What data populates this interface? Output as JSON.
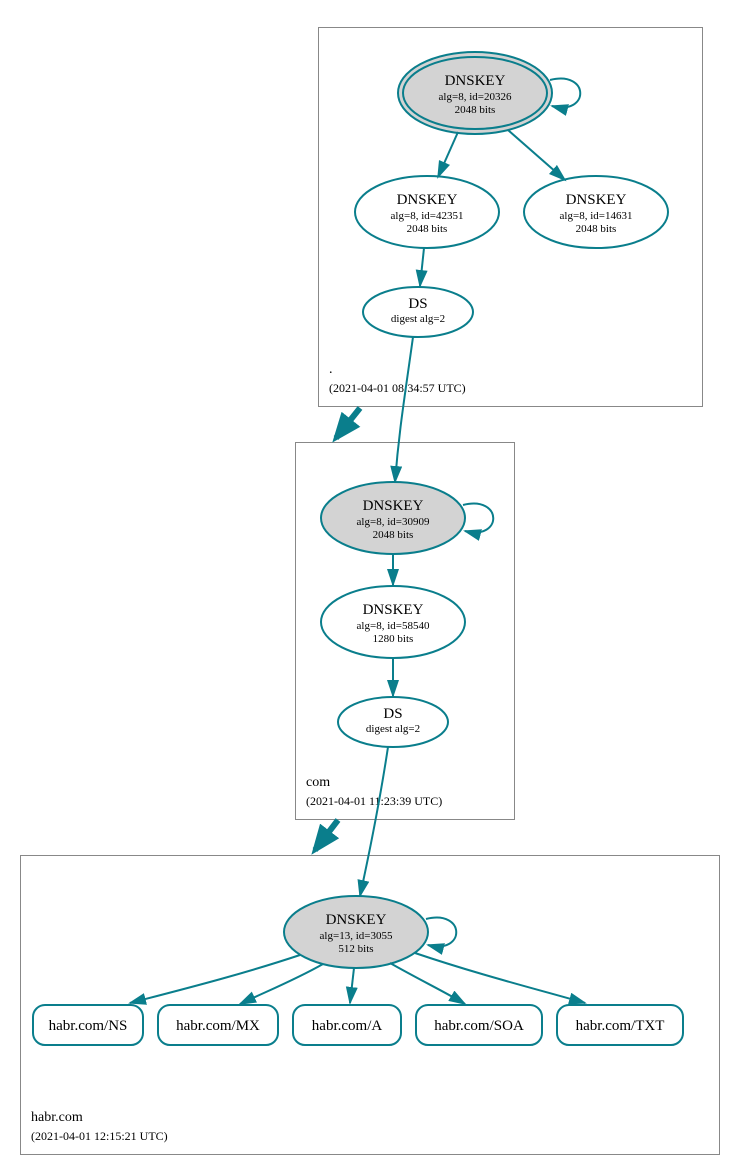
{
  "zones": {
    "root": {
      "label": ".",
      "timestamp": "(2021-04-01 08:34:57 UTC)"
    },
    "com": {
      "label": "com",
      "timestamp": "(2021-04-01 11:23:39 UTC)"
    },
    "habr": {
      "label": "habr.com",
      "timestamp": "(2021-04-01 12:15:21 UTC)"
    }
  },
  "nodes": {
    "root_ksk": {
      "title": "DNSKEY",
      "line1": "alg=8, id=20326",
      "line2": "2048 bits"
    },
    "root_zsk1": {
      "title": "DNSKEY",
      "line1": "alg=8, id=42351",
      "line2": "2048 bits"
    },
    "root_zsk2": {
      "title": "DNSKEY",
      "line1": "alg=8, id=14631",
      "line2": "2048 bits"
    },
    "root_ds": {
      "title": "DS",
      "line1": "digest alg=2"
    },
    "com_ksk": {
      "title": "DNSKEY",
      "line1": "alg=8, id=30909",
      "line2": "2048 bits"
    },
    "com_zsk": {
      "title": "DNSKEY",
      "line1": "alg=8, id=58540",
      "line2": "1280 bits"
    },
    "com_ds": {
      "title": "DS",
      "line1": "digest alg=2"
    },
    "habr_ksk": {
      "title": "DNSKEY",
      "line1": "alg=13, id=3055",
      "line2": "512 bits"
    },
    "leaf_ns": {
      "text": "habr.com/NS"
    },
    "leaf_mx": {
      "text": "habr.com/MX"
    },
    "leaf_a": {
      "text": "habr.com/A"
    },
    "leaf_soa": {
      "text": "habr.com/SOA"
    },
    "leaf_txt": {
      "text": "habr.com/TXT"
    }
  }
}
